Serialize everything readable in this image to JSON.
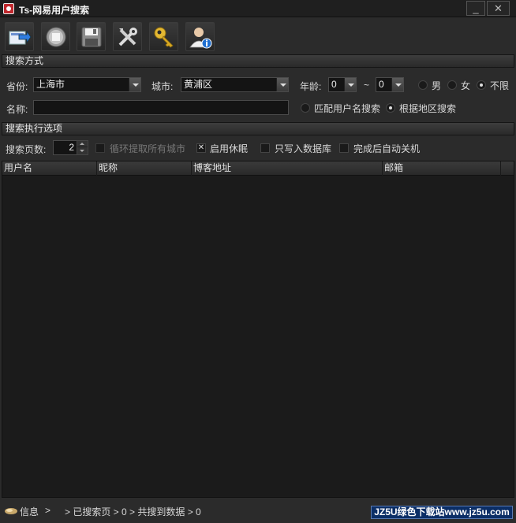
{
  "window": {
    "title": "Ts-网易用户搜索",
    "minimize_glyph": "_",
    "close_glyph": "✕"
  },
  "toolbar": {
    "buttons": [
      {
        "icon": "export-arrow-icon"
      },
      {
        "icon": "stop-icon"
      },
      {
        "icon": "save-disk-icon"
      },
      {
        "icon": "tools-icon"
      },
      {
        "icon": "key-icon"
      },
      {
        "icon": "user-info-icon"
      }
    ]
  },
  "search_mode": {
    "section_title": "搜索方式",
    "province_label": "省份:",
    "province_value": "上海市",
    "city_label": "城市:",
    "city_value": "黄浦区",
    "age_label": "年龄:",
    "age_min": "0",
    "age_sep": "~",
    "age_max": "0",
    "gender_options": [
      {
        "label": "男",
        "checked": false
      },
      {
        "label": "女",
        "checked": false
      },
      {
        "label": "不限",
        "checked": true
      }
    ],
    "name_label": "名称:",
    "name_value": "",
    "mode_options": [
      {
        "label": "匹配用户名搜索",
        "checked": false
      },
      {
        "label": "根据地区搜索",
        "checked": true
      }
    ]
  },
  "exec_options": {
    "section_title": "搜索执行选项",
    "pages_label": "搜索页数:",
    "pages_value": "2",
    "checkboxes": [
      {
        "label": "循环提取所有城市",
        "checked": false,
        "disabled": true
      },
      {
        "label": "启用休眠",
        "checked": true,
        "disabled": false
      },
      {
        "label": "只写入数据库",
        "checked": false,
        "disabled": false
      },
      {
        "label": "完成后自动关机",
        "checked": false,
        "disabled": false
      }
    ]
  },
  "table": {
    "columns": [
      "用户名",
      "昵称",
      "博客地址",
      "邮箱"
    ],
    "rows": []
  },
  "status": {
    "info_label": "信息",
    "info_sep": ">",
    "info_value": "> 已搜索页 > 0 > 共搜到数据 > 0",
    "watermark": "JZ5U绿色下载站www.jz5u.com"
  },
  "colors": {
    "background": "#2b2b2b",
    "panel": "#1b1b1b",
    "text": "#d8d8d8",
    "watermark_bg": "#0b2e66"
  }
}
